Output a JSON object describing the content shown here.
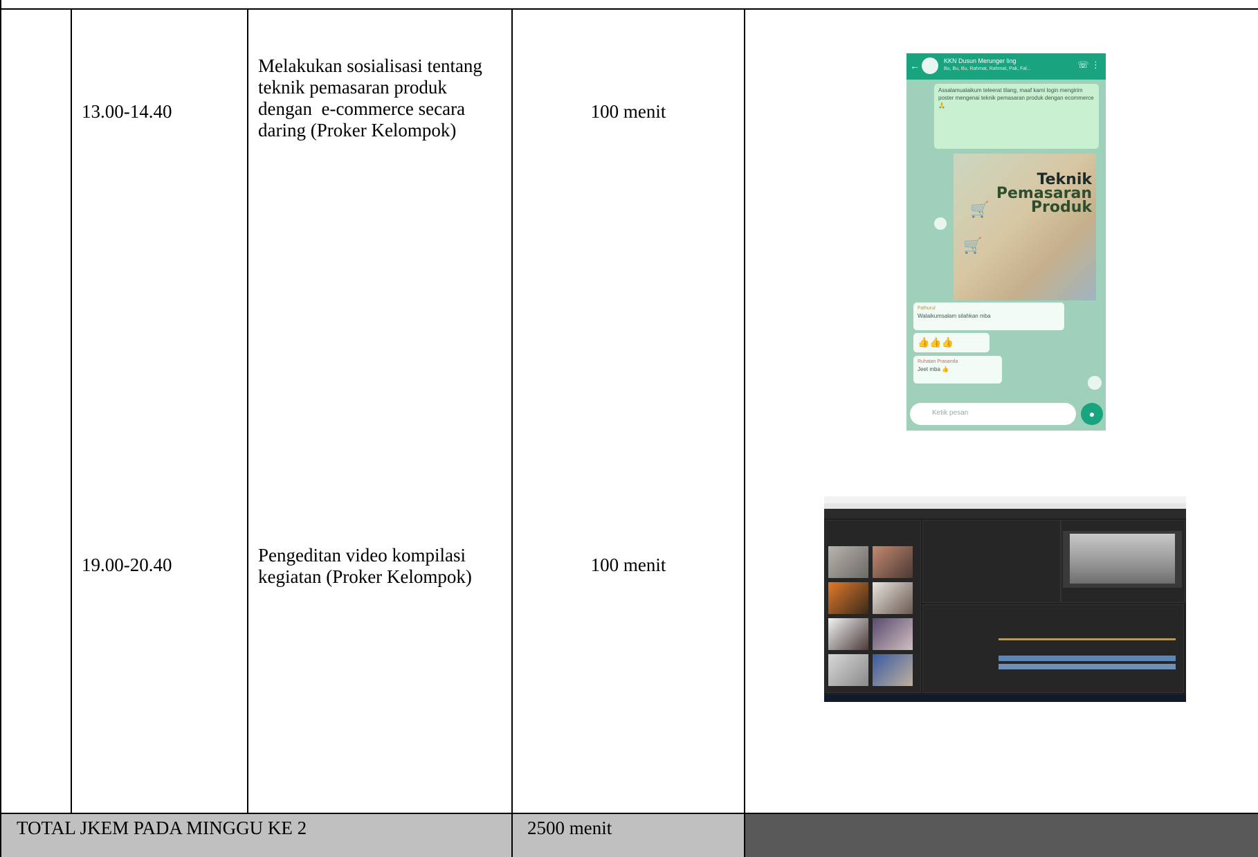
{
  "rows": [
    {
      "time": "13.00-14.40",
      "activity_lines": [
        "Melakukan sosialisasi tentang",
        "teknik pemasaran produk",
        "dengan  e-commerce secara",
        "daring (Proker Kelompok)"
      ],
      "duration": "100 menit"
    },
    {
      "time": "19.00-20.40",
      "activity_lines": [
        "Pengeditan video kompilasi",
        "kegiatan (Proker Kelompok)"
      ],
      "duration": "100 menit"
    }
  ],
  "total": {
    "label": "TOTAL JKEM PADA MINGGU KE 2",
    "value": "2500 menit"
  },
  "colors": {
    "total_row_bg": "#c0c0c0",
    "dark_cell_bg": "#595959",
    "whatsapp_green": "#1aa37f"
  },
  "whatsapp_screenshot": {
    "chat_name": "KKN Dusun Merunger ling",
    "chat_members": "Bu, Bu, Bu, Rahmat, Rahmat, Pak, Fal...",
    "message": "Assalamualaikum teleerat tilang, maaf kami login mengirim poster mengenai teknik pemasaran produk dengan ecommerce",
    "poster_title_1": "Teknik",
    "poster_title_2": "Pemasaran",
    "poster_title_3": "Produk",
    "reply1_sender": "Fathurul",
    "reply1_text": "Walaikumsalam silahkan mba",
    "reply2_sender": "Ruhatan Prasanda",
    "reply2_text": "Jeet mba",
    "input_placeholder": "Ketik pesan",
    "emoji_thumbs": "👍👍👍",
    "emoji_one_thumb": "👍",
    "emoji_pray": "🙏"
  }
}
